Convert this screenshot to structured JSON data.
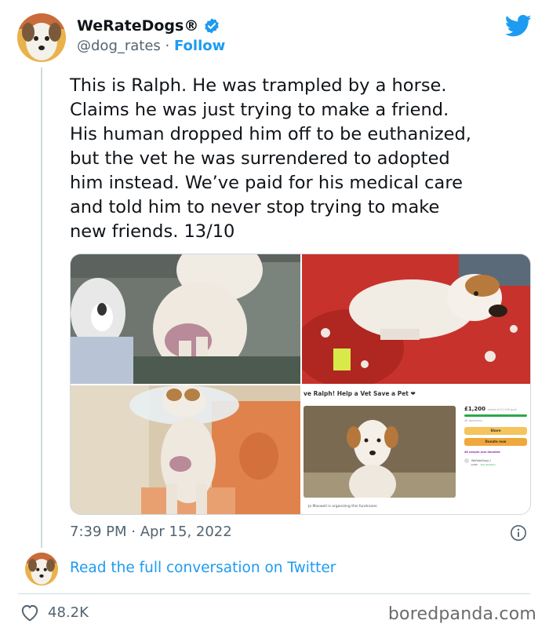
{
  "author": {
    "display_name": "WeRateDogs®",
    "handle": "@dog_rates",
    "separator": " · ",
    "follow_label": "Follow",
    "verified_color": "#1d9bf0"
  },
  "tweet": {
    "text": "This is Ralph. He was trampled by a horse.\nClaims he was just trying to make a friend.\nHis human dropped him off to be euthanized,\nbut the vet he was surrendered to adopted\nhim instead. We’ve paid for his medical care\nand told him to never stop trying to make\nnew friends. 13/10",
    "timestamp": "7:39 PM · Apr 15, 2022"
  },
  "media": {
    "fundraiser": {
      "title": "ve Ralph! Help a Vet Save a Pet ❤",
      "raised": "£1,200",
      "raised_sub": "raised of £1,000 goal",
      "progress": 1.0,
      "donations": "46 donations",
      "share_label": "Share",
      "donate_label": "Donate now",
      "recent_label": "46 people just donated",
      "donor_name": "WeRateDogs ▯",
      "donor_amount": "£400",
      "see_donation": "Top donation",
      "organizer": "Jo Maxwell is organizing this fundraiser."
    }
  },
  "footer": {
    "read_more": "Read the full conversation on Twitter",
    "likes": "48.2K"
  },
  "watermark": "boredpanda.com",
  "colors": {
    "accent": "#1d9bf0",
    "text": "#0f1419",
    "muted": "#536471"
  },
  "icons": [
    "verified-badge-icon",
    "twitter-bird-icon",
    "info-icon",
    "heart-icon"
  ]
}
